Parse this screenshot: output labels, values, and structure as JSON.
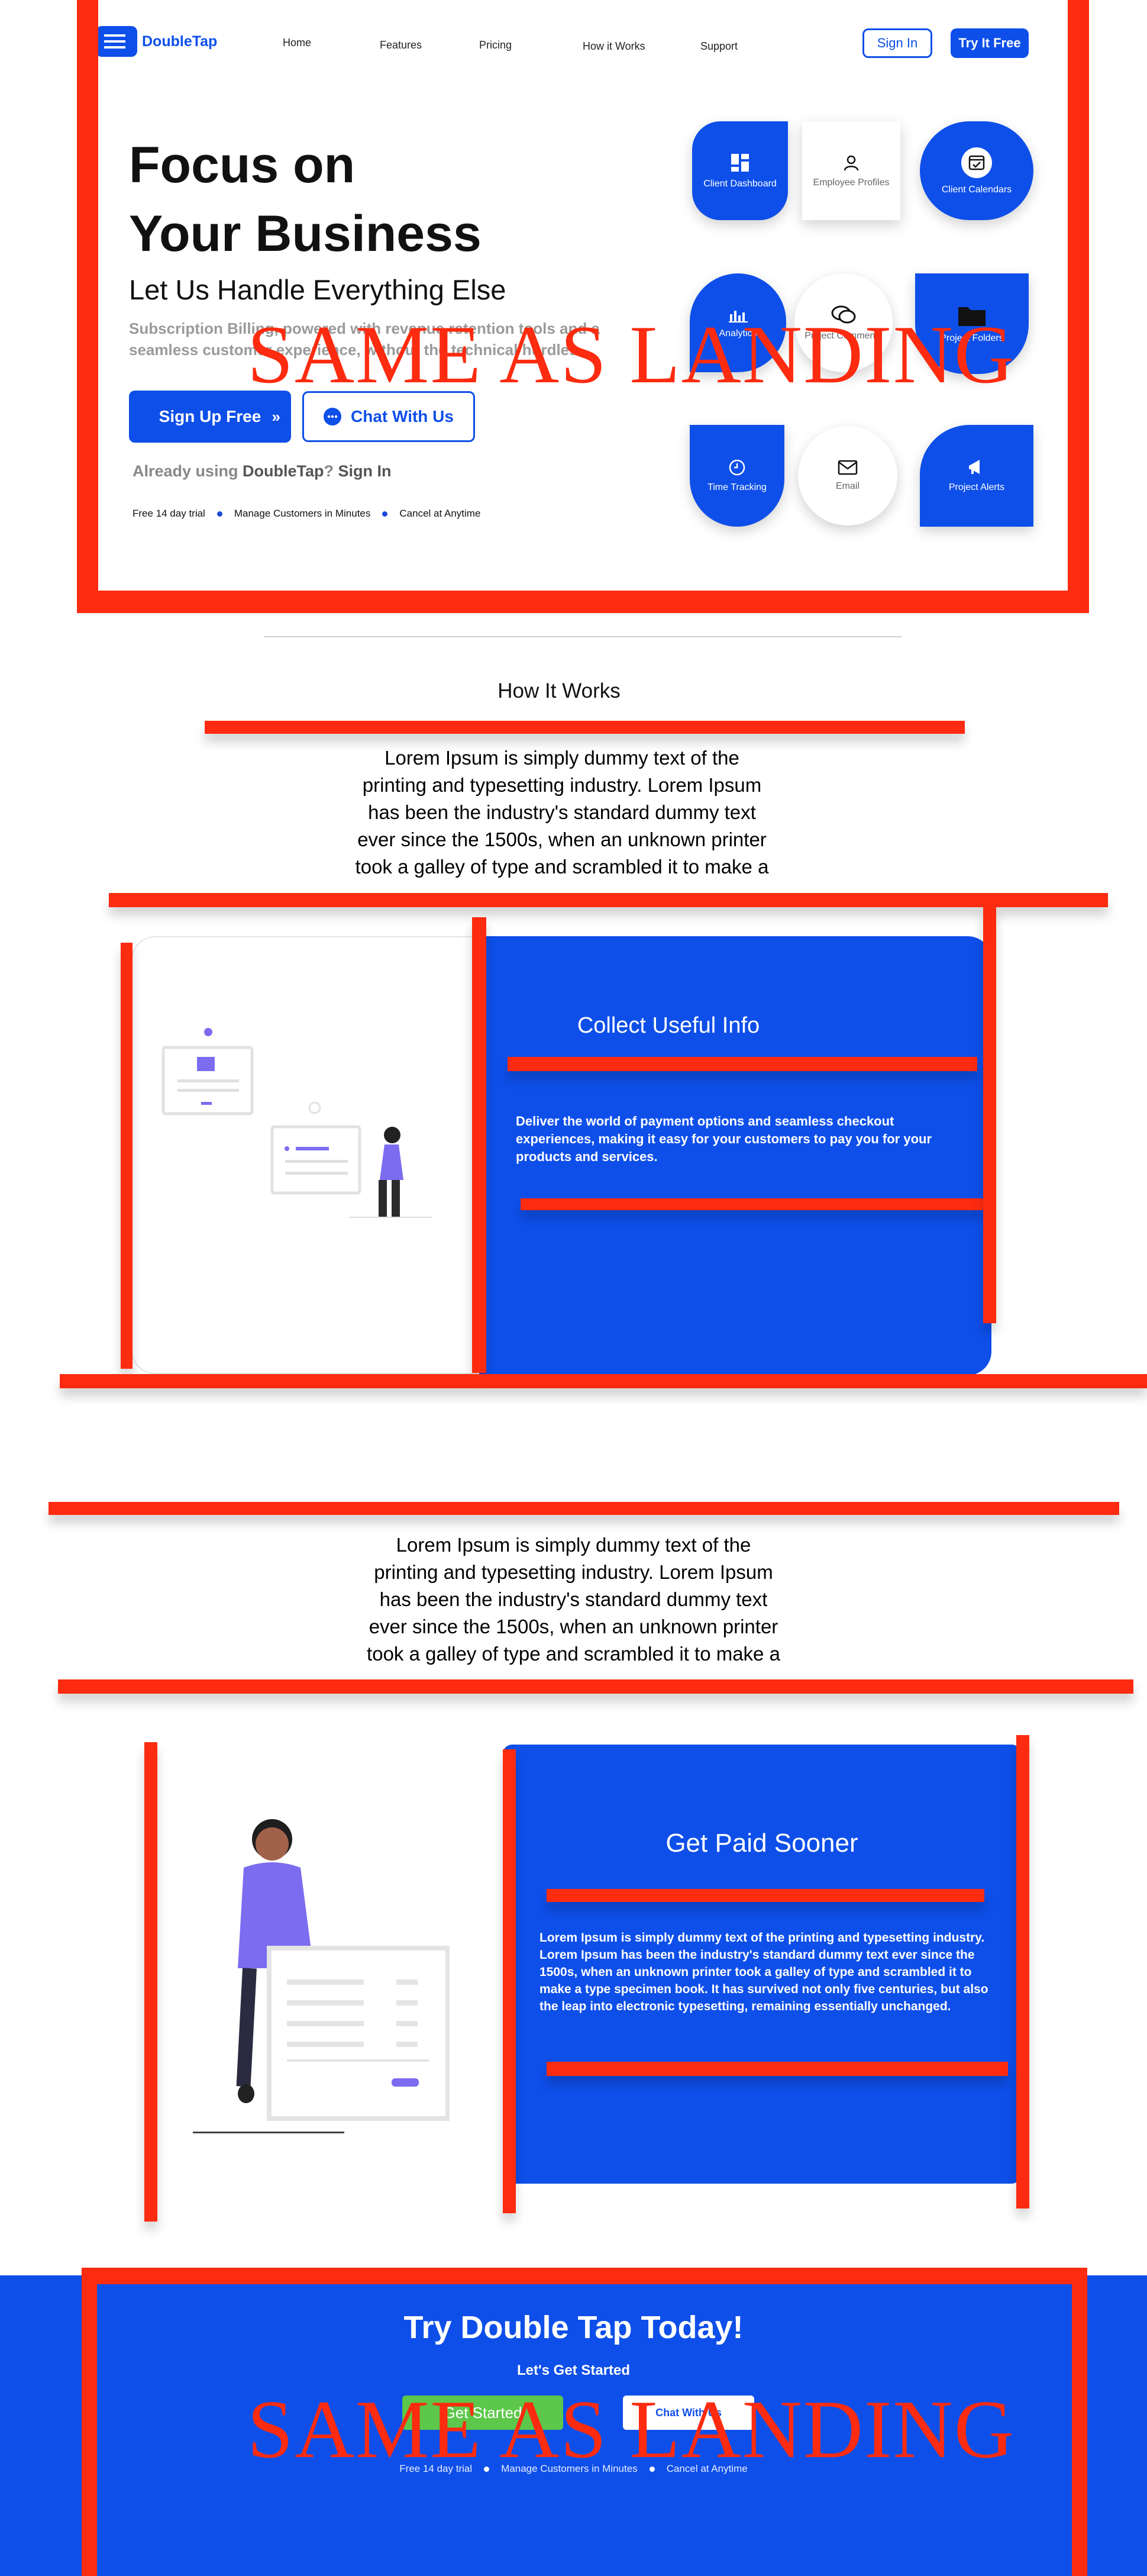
{
  "brand": {
    "name": "DoubleTap"
  },
  "nav": {
    "links": [
      "Home",
      "Features",
      "Pricing",
      "How it Works",
      "Support"
    ],
    "sign_in": "Sign In",
    "try_free": "Try It Free"
  },
  "hero": {
    "title_line1": "Focus on",
    "title_line2": "Your Business",
    "subtitle": "Let Us Handle Everything Else",
    "description_line1": "Subscription Billing, powered with revenue retention tools and a",
    "description_line2": "seamless customer experience, without the technical hurdles.",
    "signup_button": "Sign Up Free",
    "chat_button": "Chat With Us",
    "already_prefix": "Already using ",
    "already_brand": "DoubleTap",
    "already_q": "? ",
    "already_signin": "Sign In",
    "perks": [
      "Free 14 day trial",
      "Manage Customers in Minutes",
      "Cancel at Anytime"
    ]
  },
  "features_grid": [
    {
      "label": "Client Dashboard",
      "icon": "dashboard-icon"
    },
    {
      "label": "Employee Profiles",
      "icon": "user-icon"
    },
    {
      "label": "Client Calendars",
      "icon": "calendar-icon"
    },
    {
      "label": "Analytics",
      "icon": "bar-chart-icon"
    },
    {
      "label": "Project Comments",
      "icon": "comments-icon"
    },
    {
      "label": "Project Folders",
      "icon": "folder-icon"
    },
    {
      "label": "Time Tracking",
      "icon": "clock-icon"
    },
    {
      "label": "Email",
      "icon": "envelope-icon"
    },
    {
      "label": "Project Alerts",
      "icon": "megaphone-icon"
    }
  ],
  "overlay_stamp": "SAME AS LANDING",
  "how_it_works": {
    "heading": "How It Works",
    "lorem_lines": [
      "Lorem Ipsum is simply dummy text of the",
      "printing and typesetting industry. Lorem Ipsum",
      "has been the industry's standard dummy text",
      "ever since the 1500s, when an unknown printer",
      "took a galley of type and scrambled it to make a"
    ]
  },
  "card1": {
    "title": "Collect Useful Info",
    "text": "Deliver the world of payment options and seamless checkout experiences, making it easy for your customers to pay you for your products and services."
  },
  "section2": {
    "lorem_lines": [
      "Lorem Ipsum is simply dummy text of the",
      "printing and typesetting industry. Lorem Ipsum",
      "has been the industry's standard dummy text",
      "ever since the 1500s, when an unknown printer",
      "took a galley of type and scrambled it to make a"
    ]
  },
  "card2": {
    "title": "Get Paid Sooner",
    "text": "Lorem Ipsum is simply dummy text of the printing and typesetting industry. Lorem Ipsum has been the industry's standard dummy text ever since the 1500s, when an unknown printer took a galley of type and scrambled it to make a type specimen book. It has survived not only five centuries, but also the leap into electronic typesetting, remaining essentially unchanged."
  },
  "cta": {
    "title": "Try Double Tap Today!",
    "subtitle": "Let's Get Started",
    "get_started": "Get Started",
    "chat": "Chat With Us",
    "perks": [
      "Free 14 day trial",
      "Manage Customers in Minutes",
      "Cancel at Anytime"
    ]
  },
  "colors": {
    "brand_blue": "#0e4fe9",
    "annotation_red": "#fd2b0f",
    "cta_green": "#5cc74a"
  }
}
